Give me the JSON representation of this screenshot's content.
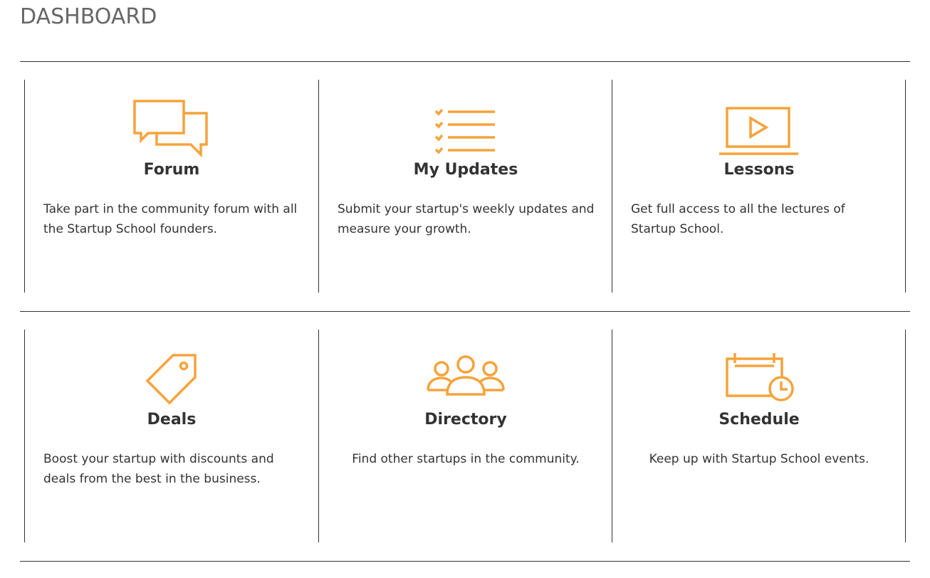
{
  "page": {
    "title": "DASHBOARD"
  },
  "accent_color": "#f5a33a",
  "cards": [
    {
      "title": "Forum",
      "description": "Take part in the community forum with all the Startup School founders.",
      "icon": "chat-bubbles-icon"
    },
    {
      "title": "My Updates",
      "description": "Submit your startup's weekly updates and measure your growth.",
      "icon": "checklist-icon"
    },
    {
      "title": "Lessons",
      "description": "Get full access to all the lectures of Startup School.",
      "icon": "video-laptop-icon"
    },
    {
      "title": "Deals",
      "description": "Boost your startup with discounts and deals from the best in the business.",
      "icon": "price-tag-icon"
    },
    {
      "title": "Directory",
      "description": "Find other startups in the community.",
      "icon": "people-group-icon"
    },
    {
      "title": "Schedule",
      "description": "Keep up with Startup School events.",
      "icon": "calendar-clock-icon"
    }
  ]
}
